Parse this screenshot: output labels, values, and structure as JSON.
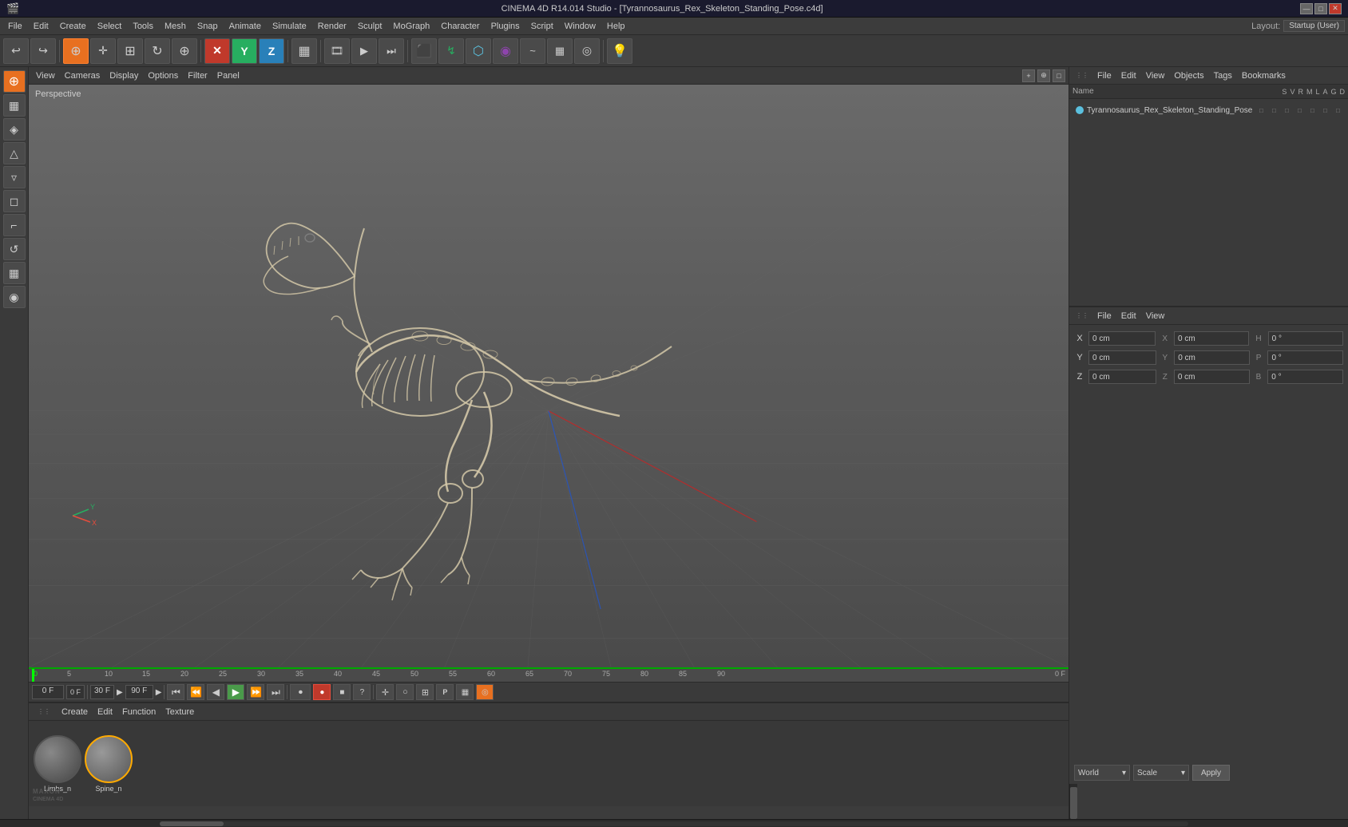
{
  "titleBar": {
    "title": "CINEMA 4D R14.014 Studio - [Tyrannosaurus_Rex_Skeleton_Standing_Pose.c4d]",
    "minimize": "—",
    "maximize": "□",
    "close": "✕"
  },
  "menuBar": {
    "items": [
      "File",
      "Edit",
      "Create",
      "Select",
      "Tools",
      "Mesh",
      "Snap",
      "Animate",
      "Simulate",
      "Render",
      "Sculpt",
      "MoGraph",
      "Character",
      "Plugins",
      "Script",
      "Window",
      "Help"
    ],
    "layout_label": "Layout:",
    "layout_value": "Startup (User)"
  },
  "leftSidebar": {
    "buttons": [
      "⬡",
      "▦",
      "◈",
      "△",
      "▿",
      "◻",
      "⌐",
      "↺",
      "▦",
      "◉"
    ]
  },
  "viewport": {
    "menus": [
      "View",
      "Cameras",
      "Display",
      "Options",
      "Filter",
      "Panel"
    ],
    "perspective_label": "Perspective"
  },
  "timeline": {
    "markers": [
      "0",
      "5",
      "10",
      "15",
      "20",
      "25",
      "30",
      "35",
      "40",
      "45",
      "50",
      "55",
      "60",
      "65",
      "70",
      "75",
      "80",
      "85",
      "90"
    ],
    "current_frame": "0 F",
    "fps": "30 F",
    "end_frame": "90 F",
    "frame_display": "0 F"
  },
  "materialArea": {
    "menus": [
      "Create",
      "Edit",
      "Function",
      "Texture"
    ],
    "materials": [
      {
        "name": "Limbs_n",
        "type": "diffuse"
      },
      {
        "name": "Spine_n",
        "type": "diffuse"
      }
    ]
  },
  "objectManager": {
    "menus": [
      "File",
      "Edit",
      "View",
      "Objects",
      "Tags",
      "Bookmarks"
    ],
    "columns": {
      "name": "Name",
      "flags": [
        "S",
        "V",
        "R",
        "M",
        "L",
        "A",
        "G",
        "D"
      ]
    },
    "objects": [
      {
        "name": "Tyrannosaurus_Rex_Skeleton_Standing_Pose",
        "color": "#5bc0de"
      }
    ]
  },
  "coordinates": {
    "menus": [
      "File",
      "Edit",
      "View"
    ],
    "rows": [
      {
        "axis": "X",
        "pos": "0 cm",
        "posLabel": "X",
        "posVal": "0 cm",
        "rot_label": "H",
        "rot_val": "0 °"
      },
      {
        "axis": "Y",
        "pos": "0 cm",
        "posLabel": "Y",
        "posVal": "0 cm",
        "rot_label": "P",
        "rot_val": "0 °"
      },
      {
        "axis": "Z",
        "pos": "0 cm",
        "posLabel": "Z",
        "posVal": "0 cm",
        "rot_label": "B",
        "rot_val": "0 °"
      }
    ],
    "coord_system": "World",
    "mode": "Scale",
    "apply_label": "Apply"
  }
}
